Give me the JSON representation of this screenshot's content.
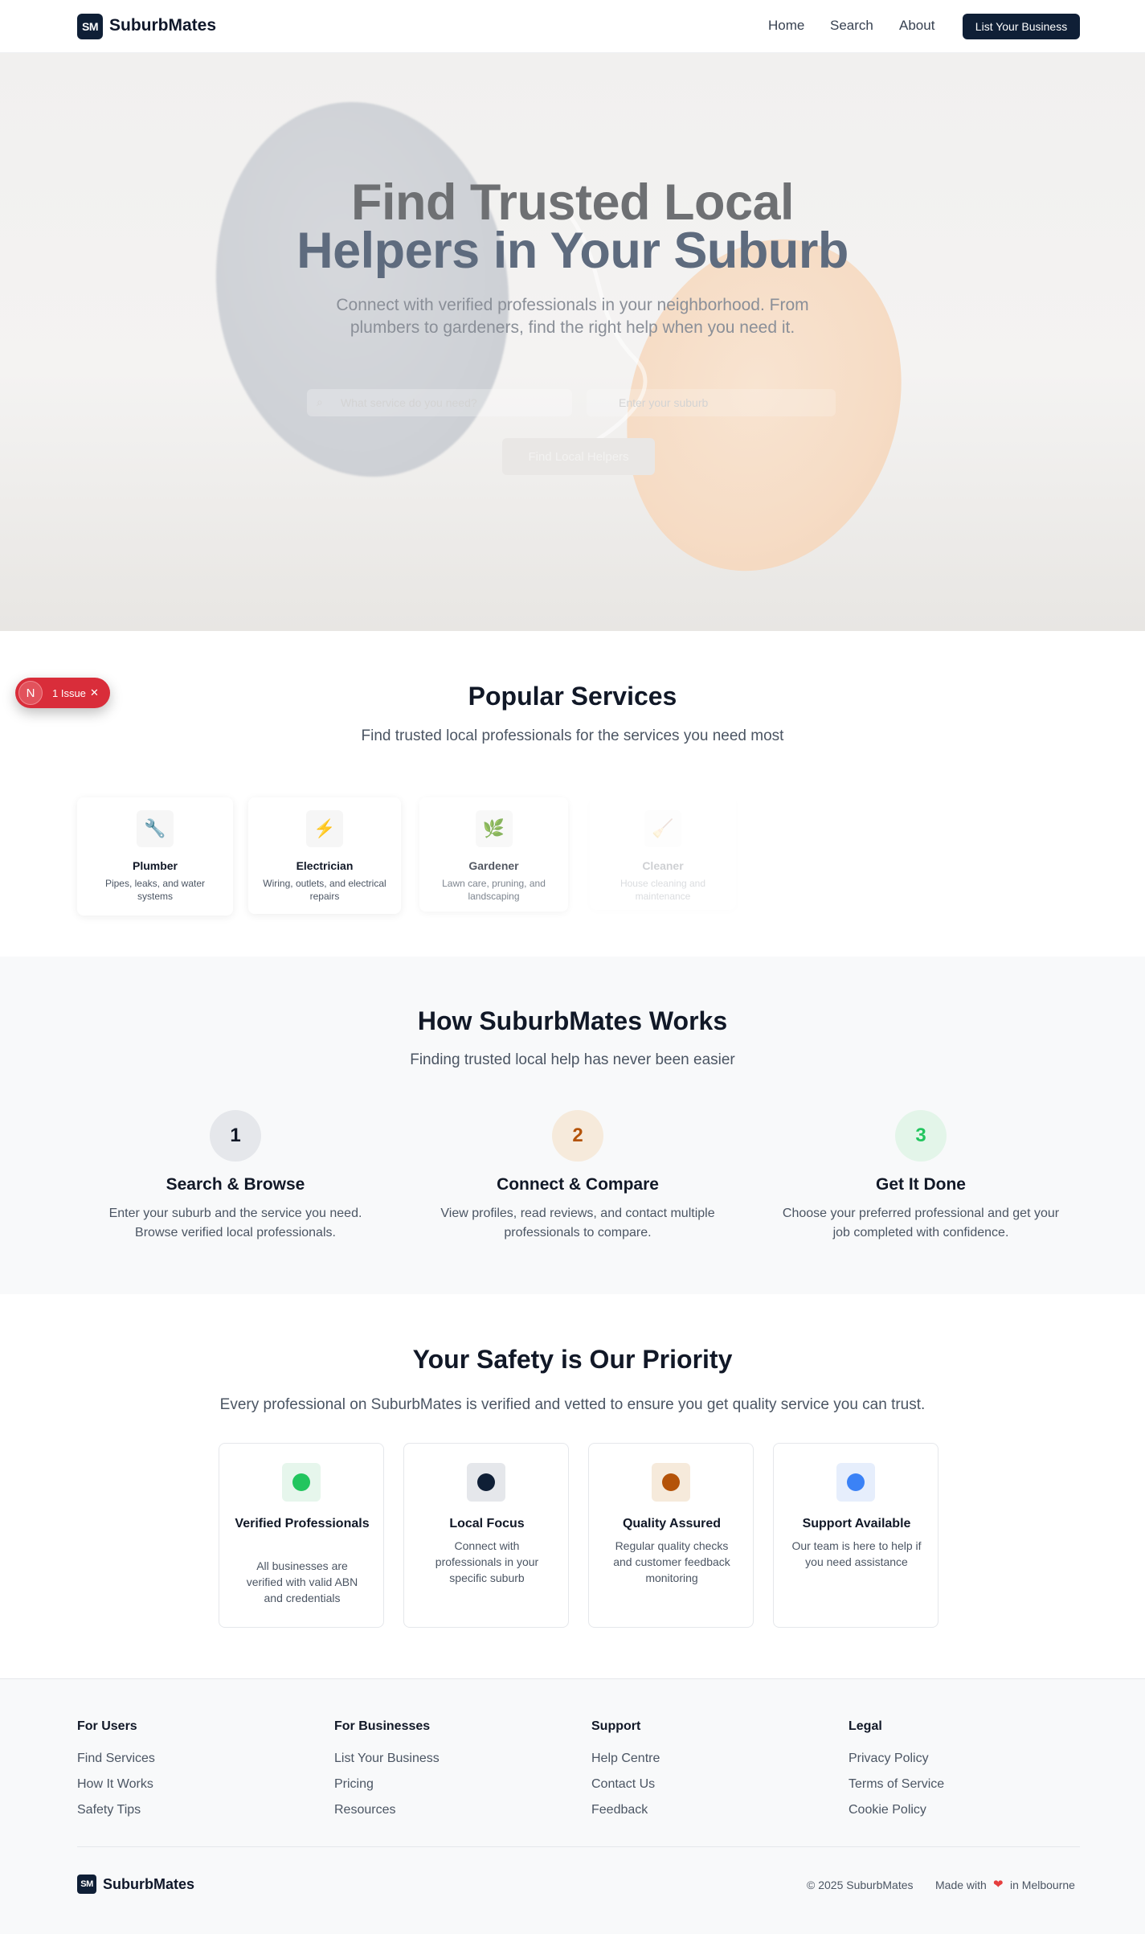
{
  "header": {
    "logo_badge": "SM",
    "brand": "SuburbMates",
    "nav": [
      "Home",
      "Search",
      "About"
    ],
    "cta": "List Your Business"
  },
  "hero": {
    "title_line1": "Find Trusted Local",
    "title_line2": "Helpers in Your Suburb",
    "subtitle_line1": "Connect with verified professionals in your neighborhood. From",
    "subtitle_line2": "plumbers to gardeners, find the right help when you need it.",
    "service_placeholder": "What service do you need?",
    "suburb_placeholder": "Enter your suburb",
    "search_button": "Find Local Helpers"
  },
  "issue_badge": {
    "initial": "N",
    "label": "1 Issue",
    "close": "✕"
  },
  "popular": {
    "title": "Popular Services",
    "subtitle": "Find trusted local professionals for the services you need most",
    "services": [
      {
        "icon": "wrench-icon",
        "glyph": "🔧",
        "name": "Plumber",
        "desc": "Pipes, leaks, and water systems"
      },
      {
        "icon": "lightning-icon",
        "glyph": "⚡",
        "name": "Electrician",
        "desc": "Wiring, outlets, and electrical repairs"
      },
      {
        "icon": "leaf-icon",
        "glyph": "🌿",
        "name": "Gardener",
        "desc": "Lawn care, pruning, and landscaping"
      },
      {
        "icon": "broom-icon",
        "glyph": "🧹",
        "name": "Cleaner",
        "desc": "House cleaning and maintenance"
      }
    ]
  },
  "how": {
    "title": "How SuburbMates Works",
    "subtitle": "Finding trusted local help has never been easier",
    "steps": [
      {
        "num": "1",
        "title": "Search & Browse",
        "line1": "Enter your suburb and the service you need.",
        "line2": "Browse verified local professionals.",
        "color": "#111827",
        "bg": "#e5e7eb"
      },
      {
        "num": "2",
        "title": "Connect & Compare",
        "line1": "View profiles, read reviews, and contact multiple",
        "line2": "professionals to compare.",
        "color": "#b45309",
        "bg": "#f6eadb"
      },
      {
        "num": "3",
        "title": "Get It Done",
        "line1": "Choose your preferred professional and get your",
        "line2": "job completed with confidence.",
        "color": "#22c55e",
        "bg": "#e3f5e9"
      }
    ]
  },
  "safety": {
    "title": "Your Safety is Our Priority",
    "subtitle": "Every professional on SuburbMates is verified and vetted to ensure you get quality service you can trust.",
    "cards": [
      {
        "title": "Verified Professionals",
        "desc": "All businesses are verified with valid ABN and credentials",
        "dot": "#22c55e",
        "bg": "#e6f6ec"
      },
      {
        "title": "Local Focus",
        "desc": "Connect with professionals in your specific suburb",
        "dot": "#0f1f36",
        "bg": "#e5e7eb"
      },
      {
        "title": "Quality Assured",
        "desc": "Regular quality checks and customer feedback monitoring",
        "dot": "#b45309",
        "bg": "#f6eadb"
      },
      {
        "title": "Support Available",
        "desc": "Our team is here to help if you need assistance",
        "dot": "#3b82f6",
        "bg": "#e6eefc"
      }
    ]
  },
  "footer": {
    "columns": [
      {
        "heading": "For Users",
        "links": [
          "Find Services",
          "How It Works",
          "Safety Tips"
        ]
      },
      {
        "heading": "For Businesses",
        "links": [
          "List Your Business",
          "Pricing",
          "Resources"
        ]
      },
      {
        "heading": "Support",
        "links": [
          "Help Centre",
          "Contact Us",
          "Feedback"
        ]
      },
      {
        "heading": "Legal",
        "links": [
          "Privacy Policy",
          "Terms of Service",
          "Cookie Policy"
        ]
      }
    ],
    "logo_badge": "SM",
    "brand": "SuburbMates",
    "copyright": "© 2025 SuburbMates",
    "made_prefix": "Made with",
    "heart": "❤",
    "made_suffix": "in Melbourne"
  },
  "colors": {
    "brand_navy": "#0f1f36",
    "issue_red": "#d92d3a",
    "heart": "#e53e3e"
  }
}
